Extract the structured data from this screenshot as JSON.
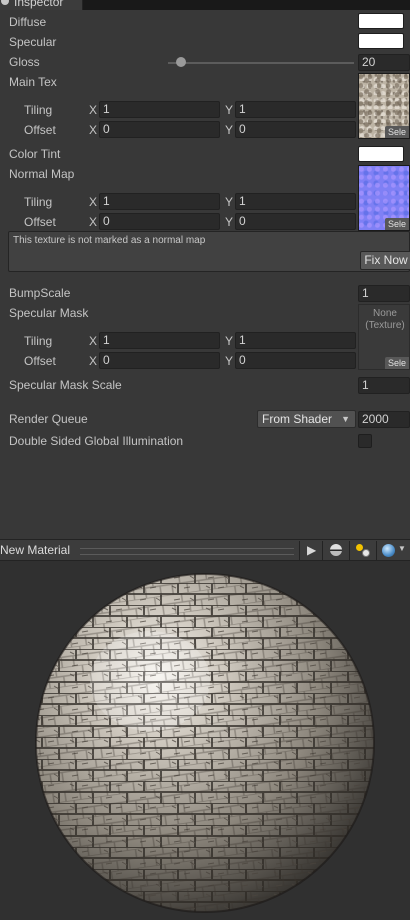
{
  "tab": {
    "title": "Inspector",
    "icon": "info-icon"
  },
  "rows": {
    "diffuse": "Diffuse",
    "specular": "Specular",
    "gloss": "Gloss",
    "gloss_value": "20",
    "gloss_slider_fraction": 0.07,
    "main_tex": "Main Tex",
    "color_tint": "Color Tint",
    "normal_map": "Normal Map",
    "bump_scale": "BumpScale",
    "bump_scale_value": "1",
    "specular_mask": "Specular Mask",
    "specular_mask_scale": "Specular Mask Scale",
    "specular_mask_scale_value": "1",
    "render_queue": "Render Queue",
    "render_queue_mode": "From Shader",
    "render_queue_value": "2000",
    "double_sided_gi": "Double Sided Global Illumination"
  },
  "common": {
    "tiling": "Tiling",
    "offset": "Offset",
    "x": "X",
    "y": "Y",
    "select": "Sele",
    "dropdown_arrow": "▼"
  },
  "main_tex": {
    "tiling_x": "1",
    "tiling_y": "1",
    "offset_x": "0",
    "offset_y": "0"
  },
  "normal_map": {
    "tiling_x": "1",
    "tiling_y": "1",
    "offset_x": "0",
    "offset_y": "0"
  },
  "specular_mask": {
    "tiling_x": "1",
    "tiling_y": "1",
    "offset_x": "0",
    "offset_y": "0",
    "none_line1": "None",
    "none_line2": "(Texture)"
  },
  "help": {
    "message": "This texture is not marked as a normal map",
    "fix_button": "Fix Now"
  },
  "preview": {
    "title": "New Material",
    "play": "▶"
  },
  "colors": {
    "diffuse": "#ffffff",
    "specular": "#ffffff",
    "color_tint": "#ffffff",
    "panel_bg": "#383838",
    "preview_bg": "#303030"
  }
}
